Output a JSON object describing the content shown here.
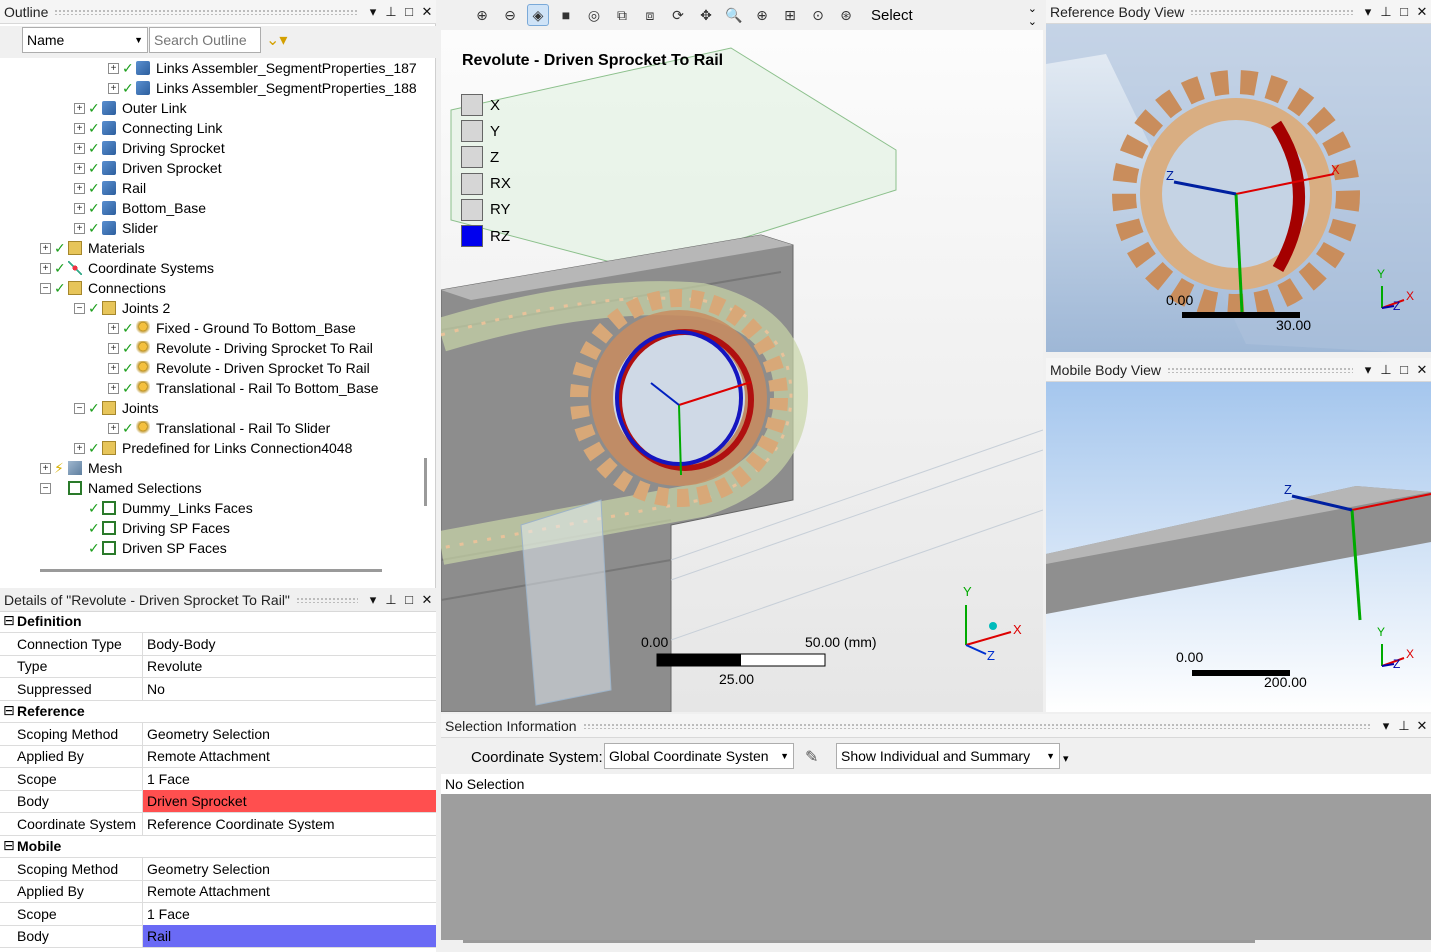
{
  "outline": {
    "title": "Outline",
    "name_dropdown": "Name",
    "search_placeholder": "Search Outline",
    "tree": [
      {
        "label": "Links Assembler_SegmentProperties_187",
        "icon": "body-icon"
      },
      {
        "label": "Links Assembler_SegmentProperties_188",
        "icon": "body-icon"
      },
      {
        "label": "Outer Link",
        "icon": "body-icon"
      },
      {
        "label": "Connecting Link",
        "icon": "body-icon"
      },
      {
        "label": "Driving Sprocket",
        "icon": "body-icon"
      },
      {
        "label": "Driven Sprocket",
        "icon": "body-icon"
      },
      {
        "label": "Rail",
        "icon": "body-icon"
      },
      {
        "label": "Bottom_Base",
        "icon": "body-icon"
      },
      {
        "label": "Slider",
        "icon": "body-icon"
      },
      {
        "label": "Materials",
        "icon": "folder-icon"
      },
      {
        "label": "Coordinate Systems",
        "icon": "coordinate-system-icon"
      },
      {
        "label": "Connections",
        "icon": "folder-icon"
      },
      {
        "label": "Joints 2",
        "icon": "folder-icon"
      },
      {
        "label": "Fixed - Ground To Bottom_Base",
        "icon": "joint-icon"
      },
      {
        "label": "Revolute - Driving Sprocket To Rail",
        "icon": "joint-icon"
      },
      {
        "label": "Revolute - Driven Sprocket To Rail",
        "icon": "joint-icon"
      },
      {
        "label": "Translational - Rail To Bottom_Base",
        "icon": "joint-icon"
      },
      {
        "label": "Joints",
        "icon": "folder-icon"
      },
      {
        "label": "Translational - Rail To Slider",
        "icon": "joint-icon"
      },
      {
        "label": "Predefined for Links Connection4048",
        "icon": "folder-icon"
      },
      {
        "label": "Mesh",
        "icon": "mesh-icon"
      },
      {
        "label": "Named Selections",
        "icon": "named-selections-icon"
      },
      {
        "label": "Dummy_Links Faces",
        "icon": "named-selection-icon"
      },
      {
        "label": "Driving SP Faces",
        "icon": "named-selection-icon"
      },
      {
        "label": "Driven SP Faces",
        "icon": "named-selection-icon"
      }
    ]
  },
  "details": {
    "title": "Details of \"Revolute - Driven Sprocket To Rail\"",
    "sections": {
      "definition": "Definition",
      "reference": "Reference",
      "mobile": "Mobile"
    },
    "rows": {
      "connection_type": {
        "k": "Connection Type",
        "v": "Body-Body"
      },
      "type": {
        "k": "Type",
        "v": "Revolute"
      },
      "suppressed": {
        "k": "Suppressed",
        "v": "No"
      },
      "ref_scoping": {
        "k": "Scoping Method",
        "v": "Geometry Selection"
      },
      "ref_applied": {
        "k": "Applied By",
        "v": "Remote Attachment"
      },
      "ref_scope": {
        "k": "Scope",
        "v": "1 Face"
      },
      "ref_body": {
        "k": "Body",
        "v": "Driven Sprocket"
      },
      "ref_cs": {
        "k": "Coordinate System",
        "v": "Reference Coordinate System"
      },
      "mob_scoping": {
        "k": "Scoping Method",
        "v": "Geometry Selection"
      },
      "mob_applied": {
        "k": "Applied By",
        "v": "Remote Attachment"
      },
      "mob_scope": {
        "k": "Scope",
        "v": "1 Face"
      },
      "mob_body": {
        "k": "Body",
        "v": "Rail"
      }
    },
    "colors": {
      "ref_body_bg": "#ff4f4f",
      "mob_body_bg": "#6a6af5"
    }
  },
  "viewport": {
    "toolbar_select": "Select",
    "title": "Revolute - Driven Sprocket To Rail",
    "dof": [
      "X",
      "Y",
      "Z",
      "RX",
      "RY",
      "RZ"
    ],
    "dof_free": "RZ",
    "scale": {
      "start": "0.00",
      "mid": "25.00",
      "end": "50.00 (mm)"
    },
    "triad": {
      "x": "X",
      "y": "Y",
      "z": "Z"
    }
  },
  "reference_view": {
    "title": "Reference Body View",
    "scale_start": "0.00",
    "scale_end": "30.00",
    "axes": {
      "x": "X",
      "y": "Y",
      "z": "Z"
    }
  },
  "mobile_view": {
    "title": "Mobile Body View",
    "scale_start": "0.00",
    "scale_end": "200.00",
    "axes": {
      "x": "X",
      "y": "Y",
      "z": "Z"
    }
  },
  "selection_info": {
    "title": "Selection Information",
    "cs_label": "Coordinate System:",
    "cs_value": "Global Coordinate Systen",
    "mode_value": "Show Individual and Summary",
    "status": "No Selection"
  }
}
